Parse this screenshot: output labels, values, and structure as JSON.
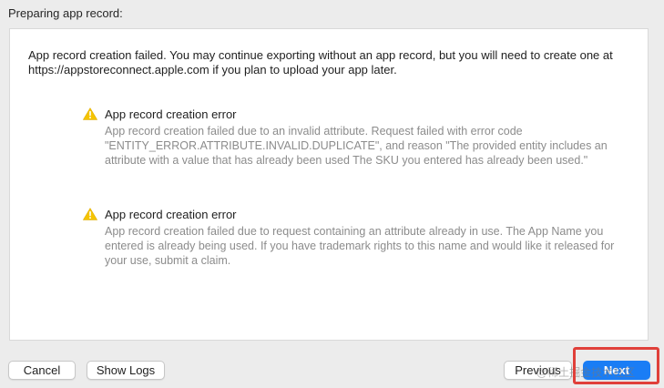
{
  "header": {
    "section_label": "Preparing app record:"
  },
  "panel": {
    "intro_text": "App record creation failed. You may continue exporting without an app record, but you will need to create one at https://appstoreconnect.apple.com if you plan to upload your app later.",
    "errors": [
      {
        "icon": "warning-icon",
        "title": "App record creation error",
        "body": "App record creation failed due to an invalid attribute. Request failed with error code \"ENTITY_ERROR.ATTRIBUTE.INVALID.DUPLICATE\", and reason \"The provided entity includes an attribute with a value that has already been used The SKU you entered has already been used.\""
      },
      {
        "icon": "warning-icon",
        "title": "App record creation error",
        "body": "App record creation failed due to request containing an attribute already in use. The App Name you entered is already being used. If you have trademark rights to this name and would like it released for your use, submit a claim."
      }
    ]
  },
  "footer": {
    "cancel_label": "Cancel",
    "show_logs_label": "Show Logs",
    "previous_label": "Previous",
    "next_label": "Next"
  },
  "watermark": "@稀土掘金技术社区",
  "colors": {
    "accent": "#1a7df5",
    "warning": "#f5c400",
    "highlight": "#e0403a"
  }
}
